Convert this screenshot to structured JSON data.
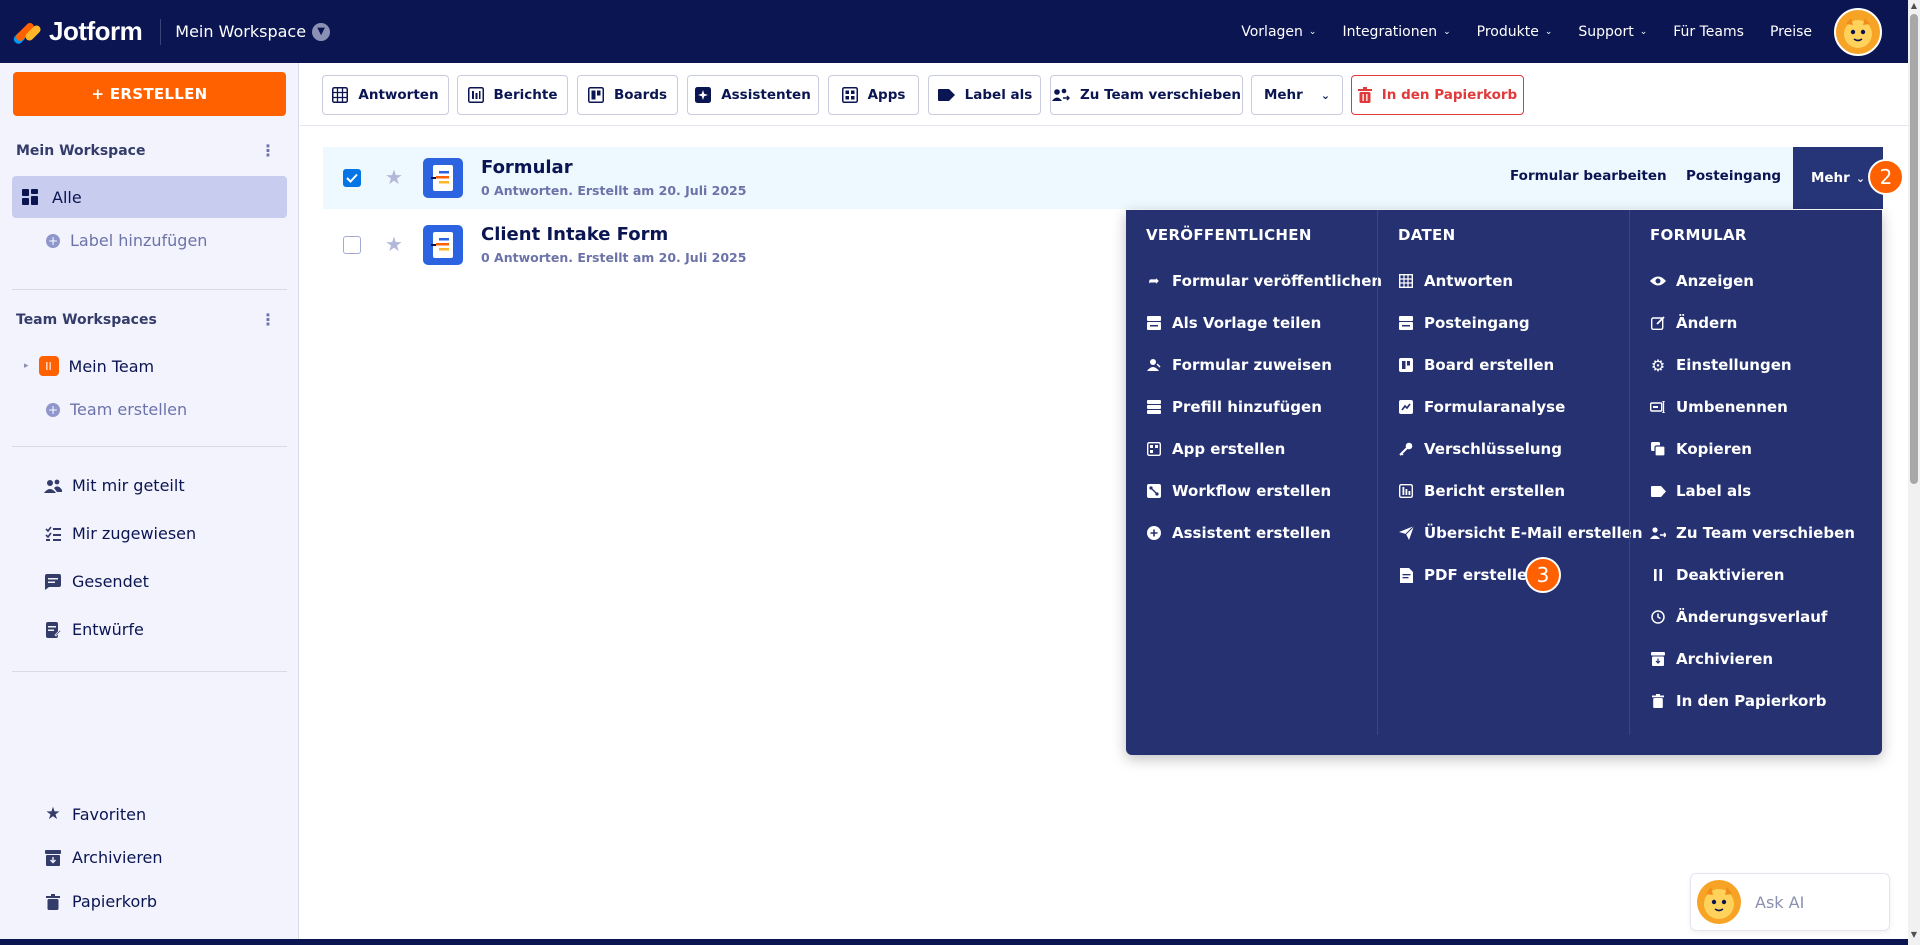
{
  "topnav": {
    "brand": "Jotform",
    "workspace": "Mein Workspace",
    "links": [
      "Vorlagen",
      "Integrationen",
      "Produkte",
      "Support",
      "Für Teams",
      "Preise"
    ]
  },
  "sidebar": {
    "create_label": "+ ERSTELLEN",
    "section_mine": "Mein Workspace",
    "all_label": "Alle",
    "add_label": "Label hinzufügen",
    "section_team": "Team Workspaces",
    "team_name": "Mein Team",
    "team_badge": "II",
    "create_team": "Team erstellen",
    "shared": "Mit mir geteilt",
    "assigned": "Mir zugewiesen",
    "sent": "Gesendet",
    "drafts": "Entwürfe",
    "favorites": "Favoriten",
    "archive": "Archivieren",
    "trash": "Papierkorb"
  },
  "toolbar": {
    "responses": "Antworten",
    "reports": "Berichte",
    "boards": "Boards",
    "assistants": "Assistenten",
    "apps": "Apps",
    "label_as": "Label als",
    "move_team": "Zu Team verschieben",
    "more": "Mehr",
    "trash": "In den Papierkorb"
  },
  "forms": [
    {
      "title": "Formular",
      "meta": "0 Antworten. Erstellt am 20. Juli 2025",
      "selected": true
    },
    {
      "title": "Client Intake Form",
      "meta": "0 Antworten. Erstellt am 20. Juli 2025",
      "selected": false
    }
  ],
  "row_actions": {
    "edit": "Formular bearbeiten",
    "inbox": "Posteingang",
    "more": "Mehr"
  },
  "step_badges": {
    "b2": "2",
    "b3": "3"
  },
  "menu": {
    "publish": {
      "head": "VERÖFFENTLICHEN",
      "items": [
        "Formular veröffentlichen",
        "Als Vorlage teilen",
        "Formular zuweisen",
        "Prefill hinzufügen",
        "App erstellen",
        "Workflow erstellen",
        "Assistent erstellen"
      ]
    },
    "data": {
      "head": "DATEN",
      "items": [
        "Antworten",
        "Posteingang",
        "Board erstellen",
        "Formularanalyse",
        "Verschlüsselung",
        "Bericht erstellen",
        "Übersicht E-Mail erstellen",
        "PDF erstellen"
      ]
    },
    "form": {
      "head": "FORMULAR",
      "items": [
        "Anzeigen",
        "Ändern",
        "Einstellungen",
        "Umbenennen",
        "Kopieren",
        "Label als",
        "Zu Team verschieben",
        "Deaktivieren",
        "Änderungsverlauf",
        "Archivieren",
        "In den Papierkorb"
      ]
    }
  },
  "ask_ai": "Ask AI",
  "colors": {
    "navy": "#0a1551",
    "orange": "#ff6100",
    "menu_bg": "#253170",
    "danger": "#e03a3a"
  }
}
